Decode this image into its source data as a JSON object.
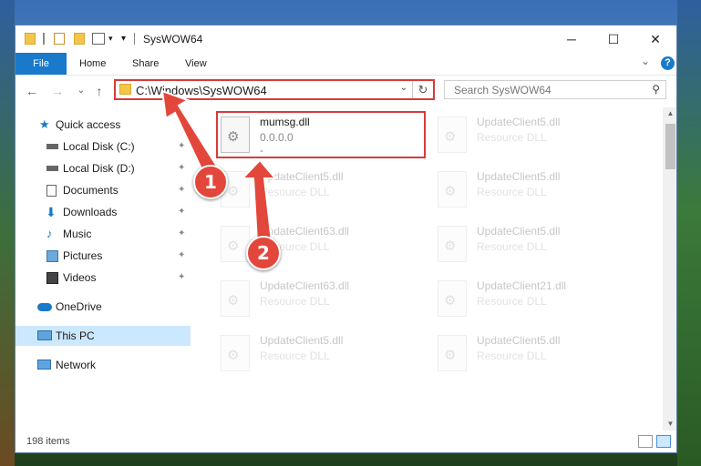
{
  "window": {
    "title": "SysWOW64"
  },
  "ribbon": {
    "tabs": [
      "File",
      "Home",
      "Share",
      "View"
    ]
  },
  "controls": {
    "minimize": "─",
    "maximize": "☐",
    "close": "✕",
    "help": "?",
    "collapse": "⌄"
  },
  "nav": {
    "back": "←",
    "forward": "→",
    "recent": "⌄",
    "up": "↑",
    "address": "C:\\Windows\\SysWOW64",
    "address_dropdown": "⌄",
    "refresh": "↻",
    "search_placeholder": "Search SysWOW64",
    "search_icon": "⚲"
  },
  "sidebar": {
    "items": [
      {
        "label": "Quick access",
        "icon": "star-icon",
        "pinned": false
      },
      {
        "label": "Local Disk (C:)",
        "icon": "drive-icon",
        "pinned": true
      },
      {
        "label": "Local Disk (D:)",
        "icon": "drive-icon",
        "pinned": true
      },
      {
        "label": "Documents",
        "icon": "document-icon",
        "pinned": true
      },
      {
        "label": "Downloads",
        "icon": "download-icon",
        "pinned": true
      },
      {
        "label": "Music",
        "icon": "music-icon",
        "pinned": true
      },
      {
        "label": "Pictures",
        "icon": "pictures-icon",
        "pinned": true
      },
      {
        "label": "Videos",
        "icon": "videos-icon",
        "pinned": true
      },
      {
        "label": "OneDrive",
        "icon": "cloud-icon",
        "pinned": false
      },
      {
        "label": "This PC",
        "icon": "pc-icon",
        "pinned": false,
        "selected": true
      },
      {
        "label": "Network",
        "icon": "network-icon",
        "pinned": false
      }
    ],
    "pin_glyph": "📌"
  },
  "files": [
    {
      "name": "mumsg.dll",
      "sub": "0.0.0.0",
      "sub2": "-"
    },
    {
      "name": "UpdateClient5.dll",
      "sub": "Resource DLL"
    },
    {
      "name": "UpdateClient5.dll",
      "sub": "Resource DLL"
    },
    {
      "name": "UpdateClient5.dll",
      "sub": "Resource DLL"
    },
    {
      "name": "UpdateClient63.dll",
      "sub": "Resource DLL"
    },
    {
      "name": "UpdateClient5.dll",
      "sub": "Resource DLL"
    },
    {
      "name": "UpdateClient63.dll",
      "sub": "Resource DLL"
    },
    {
      "name": "UpdateClient21.dll",
      "sub": "Resource DLL"
    },
    {
      "name": "UpdateClient5.dll",
      "sub": "Resource DLL"
    },
    {
      "name": "UpdateClient5.dll",
      "sub": "Resource DLL"
    }
  ],
  "status": {
    "item_count": "198 items"
  },
  "annotations": {
    "step1": "1",
    "step2": "2",
    "color": "#e3473c"
  }
}
